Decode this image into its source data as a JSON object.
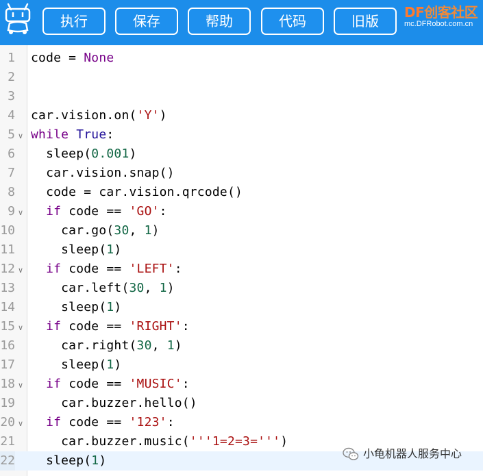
{
  "toolbar": {
    "buttons": [
      "执行",
      "保存",
      "帮助",
      "代码",
      "旧版"
    ],
    "brand_df": "DF",
    "brand_name": "创客社区",
    "brand_url": "mc.DFRobot.com.cn"
  },
  "colors": {
    "toolbar_bg": "#1c8dea",
    "keyword": "#770088",
    "builtin": "#221199",
    "string": "#aa1111",
    "number": "#116644"
  },
  "editor": {
    "active_line": 22,
    "lines": [
      {
        "n": "1",
        "fold": false,
        "segs": [
          [
            "code = ",
            ""
          ],
          [
            "None",
            "kw"
          ]
        ]
      },
      {
        "n": "2",
        "fold": false,
        "segs": []
      },
      {
        "n": "3",
        "fold": false,
        "segs": []
      },
      {
        "n": "4",
        "fold": false,
        "segs": [
          [
            "car.vision.on(",
            ""
          ],
          [
            "'Y'",
            "str"
          ],
          [
            ")",
            ""
          ]
        ]
      },
      {
        "n": "5",
        "fold": true,
        "segs": [
          [
            "while",
            "kw"
          ],
          [
            " ",
            ""
          ],
          [
            "True",
            "bi"
          ],
          [
            ":",
            ""
          ]
        ]
      },
      {
        "n": "6",
        "fold": false,
        "segs": [
          [
            "  sleep(",
            ""
          ],
          [
            "0.001",
            "num"
          ],
          [
            ")",
            ""
          ]
        ]
      },
      {
        "n": "7",
        "fold": false,
        "segs": [
          [
            "  car.vision.snap()",
            ""
          ]
        ]
      },
      {
        "n": "8",
        "fold": false,
        "segs": [
          [
            "  code = car.vision.qrcode()",
            ""
          ]
        ]
      },
      {
        "n": "9",
        "fold": true,
        "segs": [
          [
            "  ",
            ""
          ],
          [
            "if",
            "kw"
          ],
          [
            " code == ",
            ""
          ],
          [
            "'GO'",
            "str"
          ],
          [
            ":",
            ""
          ]
        ]
      },
      {
        "n": "10",
        "fold": false,
        "segs": [
          [
            "    car.go(",
            ""
          ],
          [
            "30",
            "num"
          ],
          [
            ", ",
            ""
          ],
          [
            "1",
            "num"
          ],
          [
            ")",
            ""
          ]
        ]
      },
      {
        "n": "11",
        "fold": false,
        "segs": [
          [
            "    sleep(",
            ""
          ],
          [
            "1",
            "num"
          ],
          [
            ")",
            ""
          ]
        ]
      },
      {
        "n": "12",
        "fold": true,
        "segs": [
          [
            "  ",
            ""
          ],
          [
            "if",
            "kw"
          ],
          [
            " code == ",
            ""
          ],
          [
            "'LEFT'",
            "str"
          ],
          [
            ":",
            ""
          ]
        ]
      },
      {
        "n": "13",
        "fold": false,
        "segs": [
          [
            "    car.left(",
            ""
          ],
          [
            "30",
            "num"
          ],
          [
            ", ",
            ""
          ],
          [
            "1",
            "num"
          ],
          [
            ")",
            ""
          ]
        ]
      },
      {
        "n": "14",
        "fold": false,
        "segs": [
          [
            "    sleep(",
            ""
          ],
          [
            "1",
            "num"
          ],
          [
            ")",
            ""
          ]
        ]
      },
      {
        "n": "15",
        "fold": true,
        "segs": [
          [
            "  ",
            ""
          ],
          [
            "if",
            "kw"
          ],
          [
            " code == ",
            ""
          ],
          [
            "'RIGHT'",
            "str"
          ],
          [
            ":",
            ""
          ]
        ]
      },
      {
        "n": "16",
        "fold": false,
        "segs": [
          [
            "    car.right(",
            ""
          ],
          [
            "30",
            "num"
          ],
          [
            ", ",
            ""
          ],
          [
            "1",
            "num"
          ],
          [
            ")",
            ""
          ]
        ]
      },
      {
        "n": "17",
        "fold": false,
        "segs": [
          [
            "    sleep(",
            ""
          ],
          [
            "1",
            "num"
          ],
          [
            ")",
            ""
          ]
        ]
      },
      {
        "n": "18",
        "fold": true,
        "segs": [
          [
            "  ",
            ""
          ],
          [
            "if",
            "kw"
          ],
          [
            " code == ",
            ""
          ],
          [
            "'MUSIC'",
            "str"
          ],
          [
            ":",
            ""
          ]
        ]
      },
      {
        "n": "19",
        "fold": false,
        "segs": [
          [
            "    car.buzzer.hello()",
            ""
          ]
        ]
      },
      {
        "n": "20",
        "fold": true,
        "segs": [
          [
            "  ",
            ""
          ],
          [
            "if",
            "kw"
          ],
          [
            " code == ",
            ""
          ],
          [
            "'123'",
            "str"
          ],
          [
            ":",
            ""
          ]
        ]
      },
      {
        "n": "21",
        "fold": false,
        "segs": [
          [
            "    car.buzzer.music(",
            ""
          ],
          [
            "'''1=2=3='''",
            "str"
          ],
          [
            ")",
            ""
          ]
        ]
      },
      {
        "n": "22",
        "fold": false,
        "segs": [
          [
            "  sleep(",
            ""
          ],
          [
            "1",
            "num"
          ],
          [
            ")",
            ""
          ]
        ]
      }
    ]
  },
  "watermark": {
    "text": "小龟机器人服务中心"
  }
}
